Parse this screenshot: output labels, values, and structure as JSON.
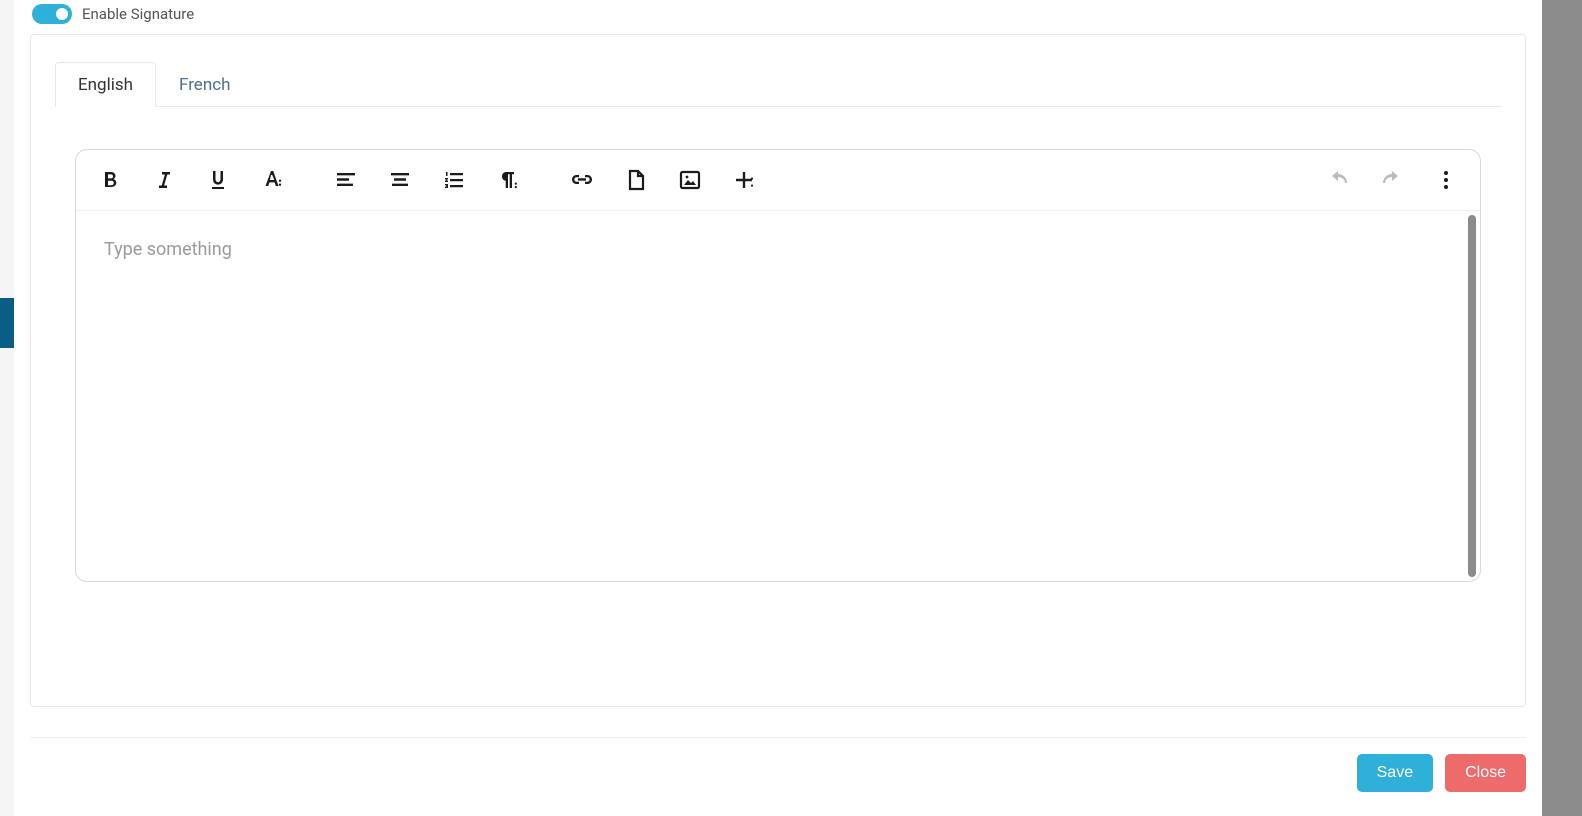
{
  "enable_signature": {
    "label": "Enable Signature",
    "value": true
  },
  "tabs": [
    {
      "label": "English",
      "active": true
    },
    {
      "label": "French",
      "active": false
    }
  ],
  "editor": {
    "placeholder": "Type something",
    "value": ""
  },
  "toolbar_icons": {
    "bold": "bold-icon",
    "italic": "italic-icon",
    "underline": "underline-icon",
    "text_style": "text-style-icon",
    "align_left": "align-left-icon",
    "align_center": "align-center-icon",
    "ordered_list": "ordered-list-icon",
    "paragraph": "paragraph-format-icon",
    "link": "link-icon",
    "file": "file-icon",
    "image": "image-icon",
    "insert": "insert-more-icon",
    "undo": "undo-icon",
    "redo": "redo-icon",
    "more": "more-vertical-icon"
  },
  "footer": {
    "save_label": "Save",
    "close_label": "Close"
  }
}
